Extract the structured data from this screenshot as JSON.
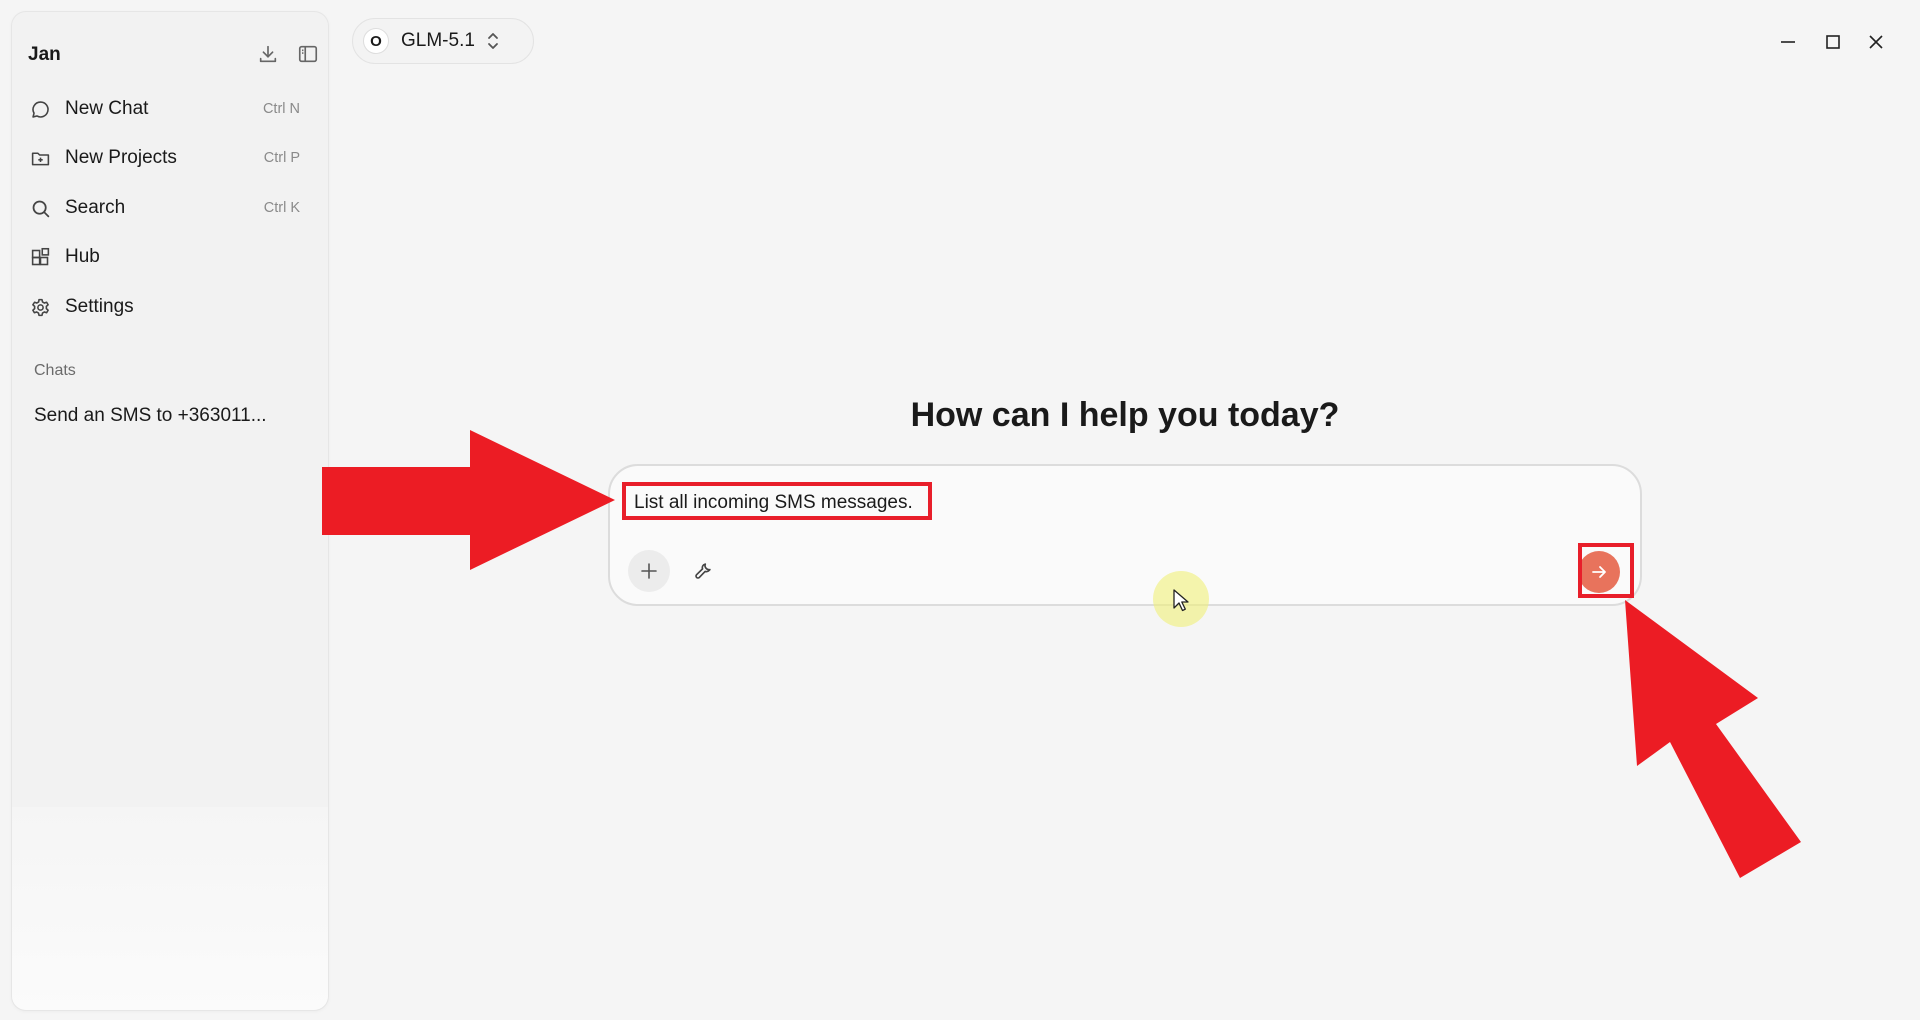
{
  "sidebar": {
    "app_name": "Jan",
    "nav": [
      {
        "label": "New Chat",
        "shortcut": "Ctrl  N",
        "icon": "chat-bubble-icon"
      },
      {
        "label": "New Projects",
        "shortcut": "Ctrl  P",
        "icon": "folder-plus-icon"
      },
      {
        "label": "Search",
        "shortcut": "Ctrl  K",
        "icon": "search-icon"
      },
      {
        "label": "Hub",
        "shortcut": "",
        "icon": "hub-blocks-icon"
      },
      {
        "label": "Settings",
        "shortcut": "",
        "icon": "gear-icon"
      }
    ],
    "section_label": "Chats",
    "chats": [
      "Send an SMS to +363011..."
    ]
  },
  "model_selector": {
    "logo_letter": "O",
    "name": "GLM-5.1"
  },
  "main": {
    "greeting": "How can I help you today?",
    "input_value": "List all incoming SMS messages."
  },
  "colors": {
    "send_button": "#e8735c",
    "annotation_red": "#e81e2a",
    "background": "#f5f5f5"
  }
}
